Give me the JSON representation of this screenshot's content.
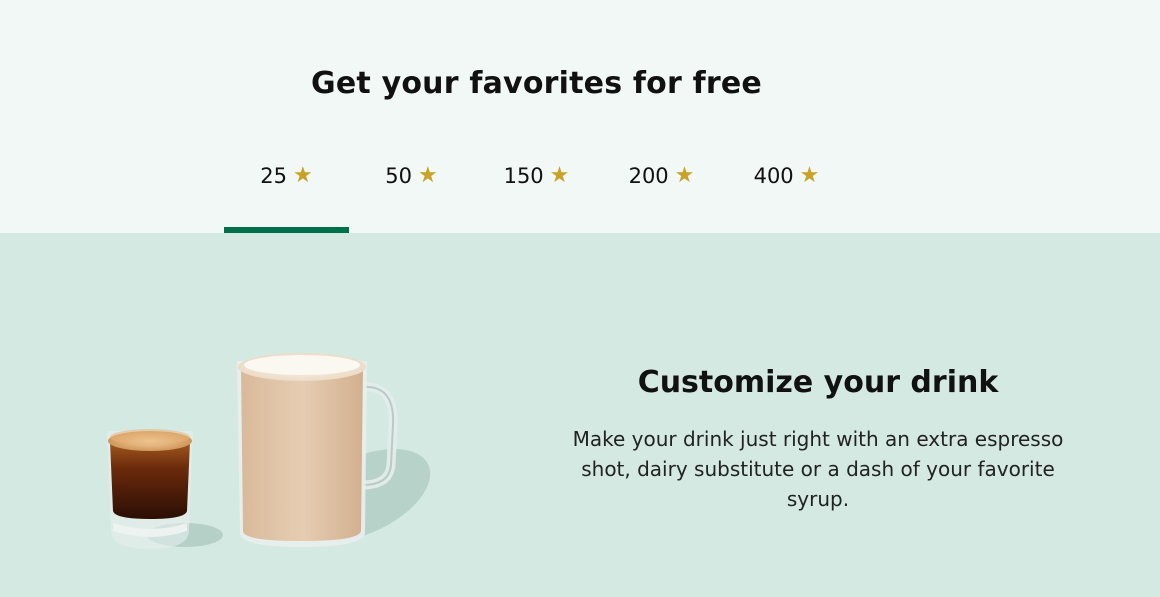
{
  "header": {
    "title": "Get your favorites for free"
  },
  "tabs": [
    {
      "value": "25",
      "icon": "star-icon",
      "active": true
    },
    {
      "value": "50",
      "icon": "star-icon",
      "active": false
    },
    {
      "value": "150",
      "icon": "star-icon",
      "active": false
    },
    {
      "value": "200",
      "icon": "star-icon",
      "active": false
    },
    {
      "value": "400",
      "icon": "star-icon",
      "active": false
    }
  ],
  "star_glyph": "★",
  "feature": {
    "title": "Customize your drink",
    "body": "Make your drink just right with an extra espresso shot, dairy substitute or a dash of your favorite syrup."
  },
  "colors": {
    "accent_green": "#00704a",
    "star_gold": "#c9a227",
    "top_bg": "#f1f8f5",
    "panel_bg": "#d4e9e2"
  }
}
